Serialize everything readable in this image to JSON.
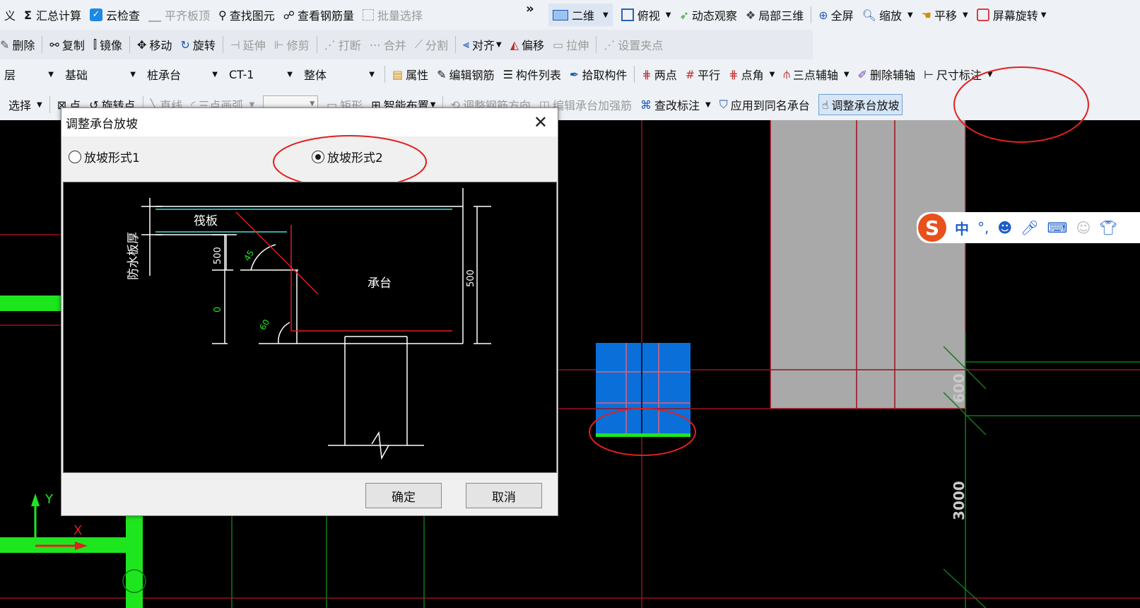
{
  "toolbar": {
    "row1": [
      {
        "label": "义",
        "icon": "text-icon",
        "disabled": false
      },
      {
        "label": "汇总计算",
        "icon": "sigma-icon",
        "disabled": false
      },
      {
        "label": "云检查",
        "icon": "check-icon",
        "disabled": false
      },
      {
        "label": "平齐板顶",
        "icon": "level-icon",
        "disabled": true
      },
      {
        "label": "查找图元",
        "icon": "binoculars-icon",
        "disabled": false
      },
      {
        "label": "查看钢筋量",
        "icon": "rebar-icon",
        "disabled": false
      },
      {
        "label": "批量选择",
        "icon": "batch-icon",
        "disabled": true
      }
    ],
    "view": [
      {
        "label": "二维",
        "icon": "2d-icon",
        "dropdown": true
      },
      {
        "label": "俯视",
        "icon": "cube-icon",
        "dropdown": true
      },
      {
        "label": "动态观察",
        "icon": "orbit-icon",
        "dropdown": false
      },
      {
        "label": "局部三维",
        "icon": "3d-icon",
        "dropdown": false
      },
      {
        "label": "全屏",
        "icon": "fullscreen-icon",
        "dropdown": false
      },
      {
        "label": "缩放",
        "icon": "zoom-icon",
        "dropdown": true
      },
      {
        "label": "平移",
        "icon": "hand-icon",
        "dropdown": true
      },
      {
        "label": "屏幕旋转",
        "icon": "rotate-screen-icon",
        "dropdown": true
      }
    ],
    "row2": [
      {
        "label": "删除",
        "icon": "delete-icon",
        "disabled": false
      },
      {
        "label": "复制",
        "icon": "copy-icon",
        "disabled": false
      },
      {
        "label": "镜像",
        "icon": "mirror-icon",
        "disabled": false
      },
      {
        "label": "移动",
        "icon": "move-icon",
        "disabled": false
      },
      {
        "label": "旋转",
        "icon": "rotate-icon",
        "disabled": false
      },
      {
        "label": "延伸",
        "icon": "extend-icon",
        "disabled": true
      },
      {
        "label": "修剪",
        "icon": "trim-icon",
        "disabled": true
      },
      {
        "label": "打断",
        "icon": "break-icon",
        "disabled": true
      },
      {
        "label": "合并",
        "icon": "merge-icon",
        "disabled": true
      },
      {
        "label": "分割",
        "icon": "split-icon",
        "disabled": true
      },
      {
        "label": "对齐",
        "icon": "align-icon",
        "disabled": false
      },
      {
        "label": "偏移",
        "icon": "offset-icon",
        "disabled": false
      },
      {
        "label": "拉伸",
        "icon": "stretch-icon",
        "disabled": true
      },
      {
        "label": "设置夹点",
        "icon": "grip-icon",
        "disabled": true
      }
    ],
    "combos": [
      "层",
      "基础",
      "桩承台",
      "CT-1",
      "整体"
    ],
    "row3": [
      {
        "label": "属性",
        "icon": "property-icon"
      },
      {
        "label": "编辑钢筋",
        "icon": "edit-rebar-icon"
      },
      {
        "label": "构件列表",
        "icon": "list-icon"
      },
      {
        "label": "拾取构件",
        "icon": "pick-icon"
      },
      {
        "label": "两点",
        "icon": "two-point-icon"
      },
      {
        "label": "平行",
        "icon": "parallel-icon"
      },
      {
        "label": "点角",
        "icon": "point-angle-icon"
      },
      {
        "label": "三点辅轴",
        "icon": "three-point-icon"
      },
      {
        "label": "删除辅轴",
        "icon": "delete-axis-icon"
      },
      {
        "label": "尺寸标注",
        "icon": "dimension-icon"
      }
    ],
    "row4": [
      {
        "label": "选择",
        "icon": "select-icon",
        "disabled": false
      },
      {
        "label": "点",
        "icon": "point-icon",
        "disabled": false
      },
      {
        "label": "旋转点",
        "icon": "rotate-point-icon",
        "disabled": false
      },
      {
        "label": "直线",
        "icon": "line-icon",
        "disabled": true
      },
      {
        "label": "三点画弧",
        "icon": "arc-icon",
        "disabled": true
      },
      {
        "label": "矩形",
        "icon": "rect-icon",
        "disabled": true
      },
      {
        "label": "智能布置",
        "icon": "smart-icon",
        "disabled": false
      },
      {
        "label": "调整钢筋方向",
        "icon": "rebar-direction-icon",
        "disabled": true
      },
      {
        "label": "编辑承台加强筋",
        "icon": "reinforce-icon",
        "disabled": true
      },
      {
        "label": "查改标注",
        "icon": "annotate-icon",
        "disabled": false
      },
      {
        "label": "应用到同名承台",
        "icon": "apply-icon",
        "disabled": false
      },
      {
        "label": "调整承台放坡",
        "icon": "slope-icon",
        "disabled": false
      }
    ]
  },
  "dialog": {
    "title": "调整承台放坡",
    "option1": "放坡形式1",
    "option2": "放坡形式2",
    "selected": "放坡形式2",
    "preview": {
      "raft_label": "筏板",
      "waterproof_label": "防水板厚",
      "cap_label": "承台",
      "dim_500_left": "500",
      "dim_0": "0",
      "dim_500_right": "500",
      "angle_45": "45",
      "angle_60": "60"
    },
    "ok": "确定",
    "cancel": "取消"
  },
  "canvas": {
    "dim_600": "600",
    "dim_3000": "3000",
    "axis_x": "X",
    "axis_y": "Y"
  },
  "ime": {
    "logo": "S",
    "lang": "中"
  },
  "colors": {
    "cap_blue": "#0a6fd8",
    "grid_red": "#9a1020",
    "grid_green": "#0f7a1a",
    "wall_green": "#1ee61e",
    "highlight_red": "#e02020"
  }
}
